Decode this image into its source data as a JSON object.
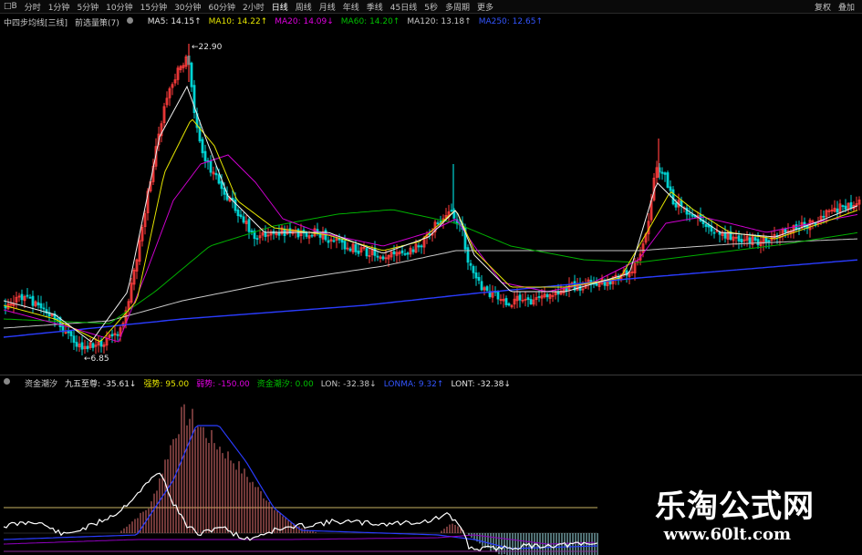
{
  "toolbar": {
    "items": [
      {
        "label": "□B"
      },
      {
        "label": "分时"
      },
      {
        "label": "1分钟"
      },
      {
        "label": "5分钟"
      },
      {
        "label": "10分钟"
      },
      {
        "label": "15分钟"
      },
      {
        "label": "30分钟"
      },
      {
        "label": "60分钟"
      },
      {
        "label": "2小时"
      },
      {
        "label": "日线",
        "active": true
      },
      {
        "label": "周线"
      },
      {
        "label": "月线"
      },
      {
        "label": "年线"
      },
      {
        "label": "季线"
      },
      {
        "label": "45日线"
      },
      {
        "label": "5秒"
      },
      {
        "label": "多周期"
      },
      {
        "label": "更多"
      }
    ],
    "right": [
      {
        "label": "复权"
      },
      {
        "label": "叠加"
      }
    ]
  },
  "price_legend": {
    "title": "中四步均线[三线]",
    "subtitle": "前选量策(7)",
    "icon": "info-circle-icon",
    "items": [
      {
        "label": "MA5: 14.15↑",
        "color": "#e6e6e6"
      },
      {
        "label": "MA10: 14.22↑",
        "color": "#e6e600"
      },
      {
        "label": "MA20: 14.09↓",
        "color": "#e000e0"
      },
      {
        "label": "MA60: 14.20↑",
        "color": "#00c000"
      },
      {
        "label": "MA120: 13.18↑",
        "color": "#c8c8c8"
      },
      {
        "label": "MA250: 12.65↑",
        "color": "#3355ff"
      }
    ]
  },
  "indicator_legend": {
    "title": "资金潮汐",
    "icon": "info-circle-icon",
    "items": [
      {
        "label": "九五至尊: -35.61↓",
        "color": "#e6e6e6"
      },
      {
        "label": "强势: 95.00",
        "color": "#e6e600"
      },
      {
        "label": "弱势: -150.00",
        "color": "#e000e0"
      },
      {
        "label": "资金潮汐: 0.00",
        "color": "#00c000"
      },
      {
        "label": "LON: -32.38↓",
        "color": "#c8c8c8"
      },
      {
        "label": "LONMA: 9.32↑",
        "color": "#3355ff"
      },
      {
        "label": "LONT: -32.38↓",
        "color": "#e6e6e6"
      }
    ]
  },
  "annotations": {
    "high": "22.90",
    "low": "6.85"
  },
  "watermark": {
    "line1": "乐淘公式网",
    "line2": "www.60lt.com"
  },
  "chart_data": [
    {
      "type": "candlestick",
      "title": "中四步均线[三线]",
      "series": [
        {
          "name": "MA5",
          "value": 14.15
        },
        {
          "name": "MA10",
          "value": 14.22
        },
        {
          "name": "MA20",
          "value": 14.09
        },
        {
          "name": "MA60",
          "value": 14.2
        },
        {
          "name": "MA120",
          "value": 13.18
        },
        {
          "name": "MA250",
          "value": 12.65
        }
      ],
      "annotations": {
        "max": 22.9,
        "min": 6.85
      },
      "ylim": [
        4,
        25
      ]
    },
    {
      "type": "bar",
      "title": "资金潮汐",
      "series": [
        {
          "name": "九五至尊",
          "value": -35.61
        },
        {
          "name": "强势",
          "value": 95.0
        },
        {
          "name": "弱势",
          "value": -150.0
        },
        {
          "name": "资金潮汐",
          "value": 0.0
        },
        {
          "name": "LON",
          "value": -32.38
        },
        {
          "name": "LONMA",
          "value": 9.32
        },
        {
          "name": "LONT",
          "value": -32.38
        }
      ]
    }
  ]
}
